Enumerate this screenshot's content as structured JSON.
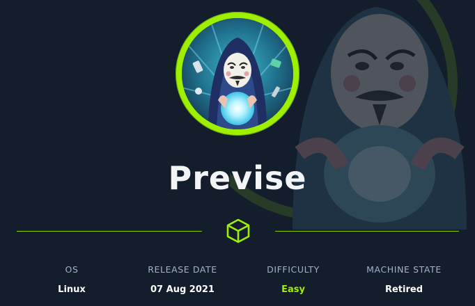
{
  "machine": {
    "name": "Previse"
  },
  "info": [
    {
      "label": "OS",
      "value": "Linux"
    },
    {
      "label": "RELEASE DATE",
      "value": "07 Aug 2021"
    },
    {
      "label": "DIFFICULTY",
      "value": "Easy"
    },
    {
      "label": "MACHINE STATE",
      "value": "Retired"
    }
  ],
  "colors": {
    "background": "#141d2b",
    "accent": "#9fef00",
    "label": "#a4b1cd",
    "value": "#ffffff"
  },
  "icons": {
    "divider": "cube-icon",
    "avatar": "masked-hacker-avatar"
  }
}
